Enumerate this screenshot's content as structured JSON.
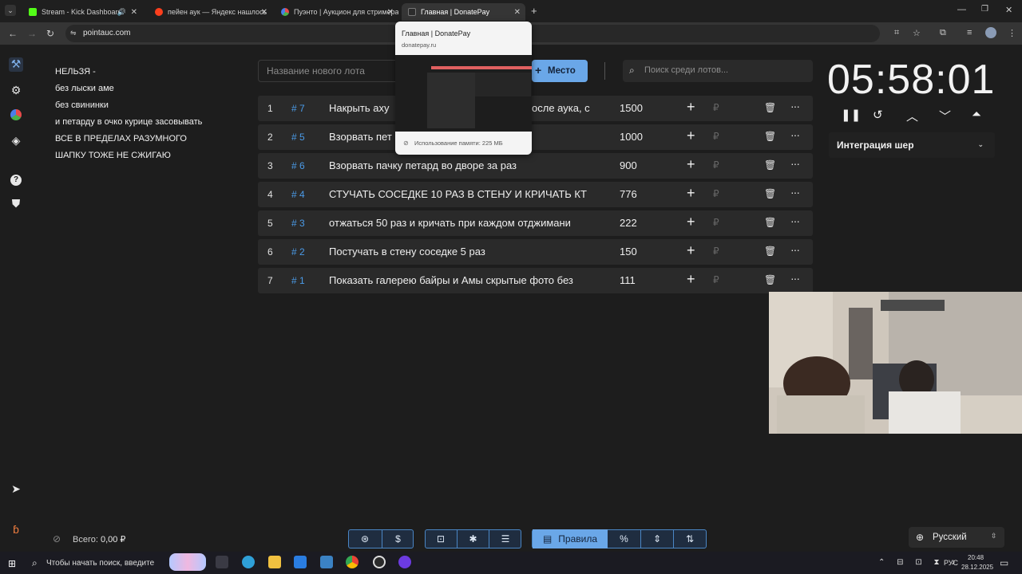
{
  "browser": {
    "tabs": [
      {
        "title": "Stream - Kick Dashboard",
        "color": "#53fc18"
      },
      {
        "title": "пейен аук — Яндекс нашлось",
        "color": "#fc3f1d"
      },
      {
        "title": "Пуэнто | Аукцион для стримера",
        "color": "#9aa0a6"
      },
      {
        "title": "Главная | DonatePay",
        "color": "#3a3a3a"
      }
    ],
    "url": "pointauc.com"
  },
  "popup": {
    "title": "Главная | DonatePay",
    "url": "donatepay.ru",
    "memory": "Использование памяти: 225 МБ"
  },
  "rules": [
    "НЕЛЬЗЯ -",
    "без лыски аме",
    "без свининки",
    "и петарду в очко курице засовывать",
    "ВСЕ В ПРЕДЕЛАХ РАЗУМНОГО",
    "ШАПКУ ТОЖЕ НЕ СЖИГАЮ"
  ],
  "toolbar": {
    "lot_placeholder": "Название нового лота",
    "place_label": "Место",
    "search_placeholder": "Поиск среди лотов..."
  },
  "lots": [
    {
      "index": "1",
      "number": "# 7",
      "name": "Накрыть аху",
      "name2": "осле аука, с",
      "amount": "1500"
    },
    {
      "index": "2",
      "number": "# 5",
      "name": "Взорвать пет",
      "name2": "",
      "amount": "1000"
    },
    {
      "index": "3",
      "number": "# 6",
      "name": "Взорвать пачку петард во дворе за раз",
      "name2": "",
      "amount": "900"
    },
    {
      "index": "4",
      "number": "# 4",
      "name": "СТУЧАТЬ СОСЕДКЕ 10 РАЗ В СТЕНУ И КРИЧАТЬ КТ",
      "name2": "",
      "amount": "776"
    },
    {
      "index": "5",
      "number": "# 3",
      "name": "отжаться 50 раз и кричать при каждом отджимани",
      "name2": "",
      "amount": "222"
    },
    {
      "index": "6",
      "number": "# 2",
      "name": "Постучать в стену соседке 5 раз",
      "name2": "",
      "amount": "150"
    },
    {
      "index": "7",
      "number": "# 1",
      "name": "Показать галерею байры и Амы скрытые фото без",
      "name2": "",
      "amount": "111"
    }
  ],
  "lot_actions": {
    "plus": "+",
    "currency": "₽",
    "more": "···"
  },
  "timer": {
    "value": "05:58:01"
  },
  "integration": {
    "label": "Интеграция шер"
  },
  "footer": {
    "total_label": "Всего:",
    "total_value": "0,00 ₽",
    "rules_label": "Правила",
    "language": "Русский"
  },
  "taskbar": {
    "search_placeholder": "Чтобы начать поиск, введите",
    "lang": "РУС",
    "time": "20:48",
    "date": "28.12.2025"
  }
}
